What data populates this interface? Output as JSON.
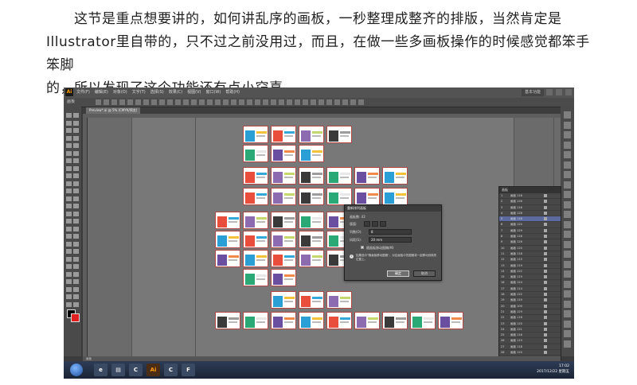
{
  "article": {
    "lines": [
      "这节是重点想要讲的，如何讲乱序的画板，一秒整理成整齐的排版，当然肯定是",
      "Illustrator里自带的，只不过之前没用过，而且，在做一些多画板操作的时候感觉都笨手笨脚",
      "的，所以发现了这个功能还有点小窃喜。"
    ]
  },
  "app": {
    "logo": "Ai",
    "menu": [
      "文件(F)",
      "编辑(E)",
      "对象(O)",
      "文字(T)",
      "选择(S)",
      "效果(C)",
      "视图(V)",
      "窗口(W)",
      "帮助(H)"
    ],
    "workspace": "基本功能",
    "control_label": "画板",
    "doc_tab": "Preview*.ai @ 5% (CMYK/预览)"
  },
  "layers_panel": {
    "tab": "画板",
    "rows": [
      {
        "num": "1",
        "name": "画板 116"
      },
      {
        "num": "2",
        "name": "画板 126"
      },
      {
        "num": "3",
        "name": "画板 116"
      },
      {
        "num": "4",
        "name": "画板 128"
      },
      {
        "num": "5",
        "name": "画板 118"
      },
      {
        "num": "6",
        "name": "画板 120"
      },
      {
        "num": "7",
        "name": "画板 129"
      },
      {
        "num": "8",
        "name": "画板 116"
      },
      {
        "num": "9",
        "name": "画板 126"
      },
      {
        "num": "10",
        "name": "画板 120"
      },
      {
        "num": "11",
        "name": "画板 118"
      },
      {
        "num": "12",
        "name": "画板 115"
      },
      {
        "num": "13",
        "name": "画板 119"
      },
      {
        "num": "14",
        "name": "画板 122"
      },
      {
        "num": "15",
        "name": "画板 119"
      },
      {
        "num": "16",
        "name": "画板 124"
      },
      {
        "num": "17",
        "name": "画板 114"
      },
      {
        "num": "18",
        "name": "画板 122"
      },
      {
        "num": "19",
        "name": "画板 119"
      },
      {
        "num": "20",
        "name": "画板 109"
      },
      {
        "num": "21",
        "name": "画板 129"
      },
      {
        "num": "22",
        "name": "画板 116"
      },
      {
        "num": "23",
        "name": "画板 120"
      },
      {
        "num": "24",
        "name": "画板 121"
      },
      {
        "num": "25",
        "name": "画板 116"
      },
      {
        "num": "26",
        "name": "画板 119"
      },
      {
        "num": "27",
        "name": "画板 118"
      },
      {
        "num": "28",
        "name": "画板 120"
      },
      {
        "num": "29",
        "name": "画板 125"
      },
      {
        "num": "30",
        "name": "画板 111"
      },
      {
        "num": "31",
        "name": "画板 119"
      }
    ],
    "selected_index": 4
  },
  "dialog": {
    "title": "重新排列画板",
    "count_label": "画板数: 43",
    "layout_label": "版面:",
    "columns_label": "列数(O):",
    "columns_value": "8",
    "spacing_label": "间距(S):",
    "spacing_value": "20 mm",
    "move_art_label": "随画板移动图稿(M)",
    "info_text": "如果选中\"随画板移动图稿\"，对应画板中的图稿将一起移动到新的位置上。",
    "ok_label": "确定",
    "cancel_label": "取消"
  },
  "statusbar": {
    "text": "画板"
  },
  "taskbar": {
    "time": "17:02",
    "date": "2017/12/22 星期五"
  },
  "colors": {
    "artboard_border": "#b14848",
    "selected_row": "#5c6aa0"
  }
}
